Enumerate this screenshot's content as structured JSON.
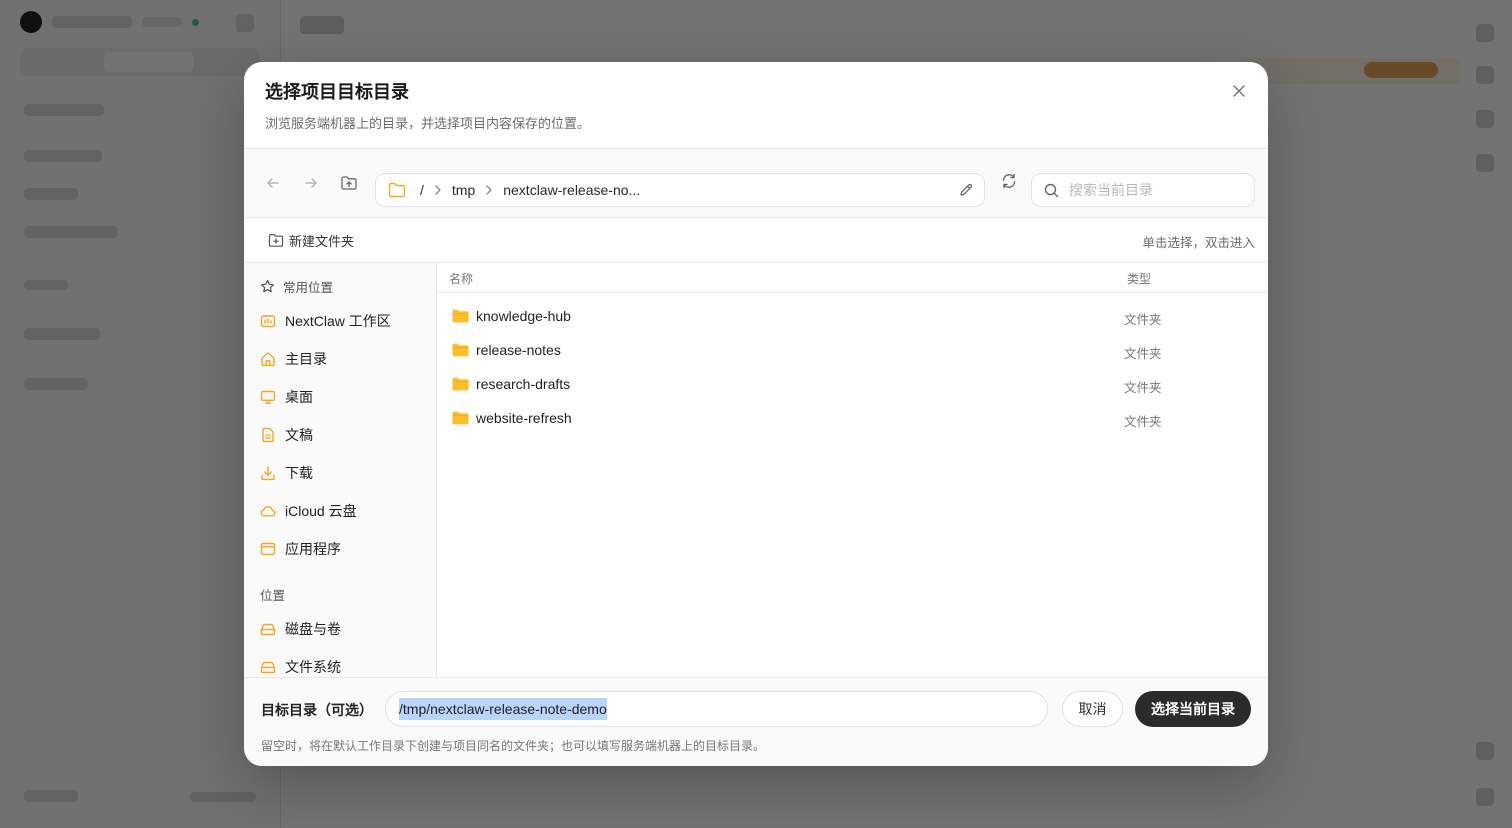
{
  "dialog": {
    "title": "选择项目目标目录",
    "subtitle": "浏览服务端机器上的目录，并选择项目内容保存的位置。"
  },
  "toolbar": {
    "breadcrumbs": [
      "/",
      "tmp",
      "nextclaw-release-no..."
    ],
    "search_placeholder": "搜索当前目录"
  },
  "actions": {
    "new_folder_label": "新建文件夹",
    "hint": "单击选择，双击进入"
  },
  "sidebar": {
    "favorites_title": "常用位置",
    "favorites": [
      {
        "label": "NextClaw 工作区",
        "icon": "workspace-icon"
      },
      {
        "label": "主目录",
        "icon": "home-icon"
      },
      {
        "label": "桌面",
        "icon": "desktop-icon"
      },
      {
        "label": "文稿",
        "icon": "document-icon"
      },
      {
        "label": "下载",
        "icon": "download-icon"
      },
      {
        "label": "iCloud 云盘",
        "icon": "cloud-icon"
      },
      {
        "label": "应用程序",
        "icon": "applications-icon"
      }
    ],
    "locations_title": "位置",
    "locations": [
      {
        "label": "磁盘与卷",
        "icon": "drive-icon"
      },
      {
        "label": "文件系统",
        "icon": "drive-icon"
      }
    ]
  },
  "list": {
    "columns": {
      "name": "名称",
      "type": "类型"
    },
    "rows": [
      {
        "name": "knowledge-hub",
        "type": "文件夹"
      },
      {
        "name": "release-notes",
        "type": "文件夹"
      },
      {
        "name": "research-drafts",
        "type": "文件夹"
      },
      {
        "name": "website-refresh",
        "type": "文件夹"
      }
    ]
  },
  "footer": {
    "target_label": "目标目录（可选）",
    "target_value": "/tmp/nextclaw-release-note-demo",
    "cancel_label": "取消",
    "select_label": "选择当前目录",
    "note": "留空时，将在默认工作目录下创建与项目同名的文件夹；也可以填写服务端机器上的目标目录。"
  },
  "colors": {
    "accent": "#f5a623",
    "primary_button": "#2b2b2b",
    "selection": "#b9d5fb"
  }
}
